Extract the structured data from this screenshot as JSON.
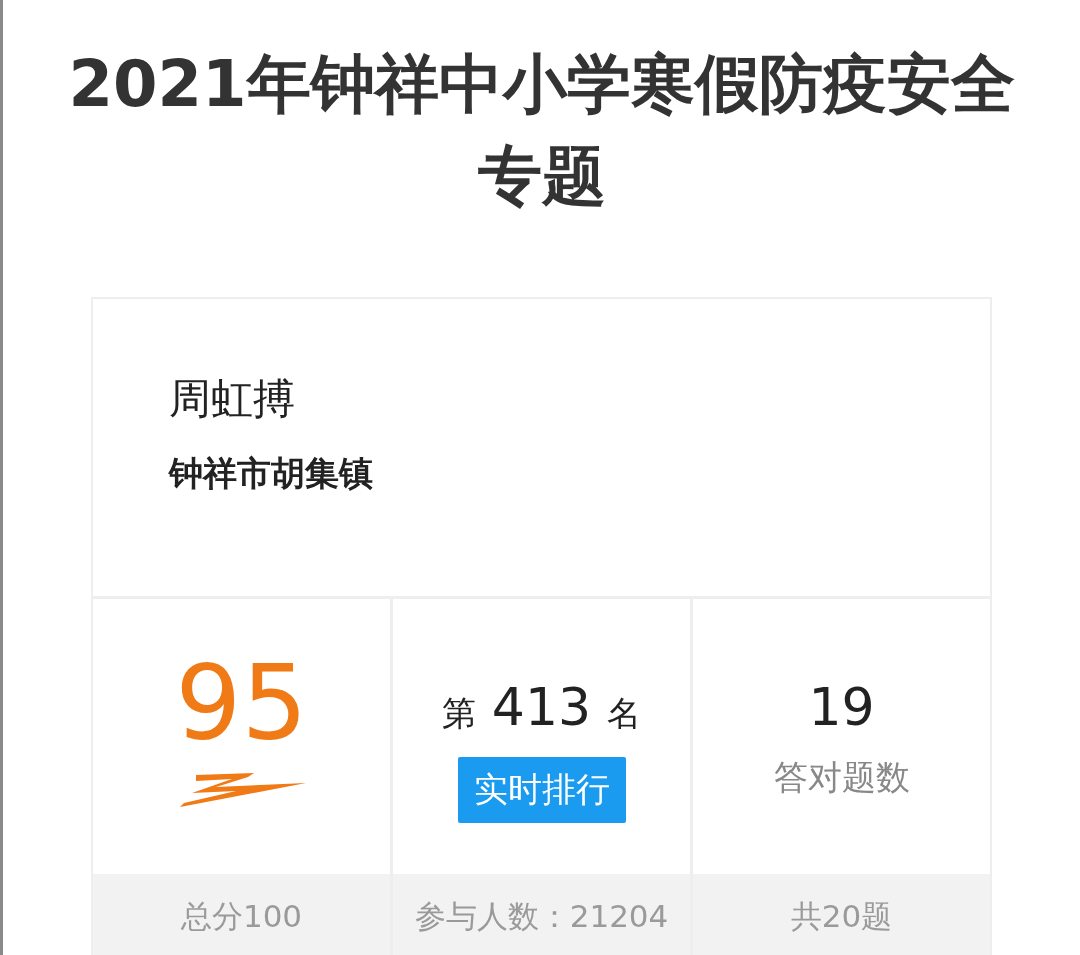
{
  "title": "2021年钟祥中小学寒假防疫安全专题",
  "profile": {
    "name": "周虹搏",
    "region": "钟祥市胡集镇"
  },
  "stats": [
    {
      "kind": "score",
      "value": "95",
      "footer": "总分100"
    },
    {
      "kind": "rank",
      "prefix": "第",
      "value": "413",
      "suffix": "名",
      "button": "实时排行",
      "footer": "参与人数：21204"
    },
    {
      "kind": "count",
      "value": "19",
      "caption": "答对题数",
      "footer": "共20题"
    }
  ]
}
